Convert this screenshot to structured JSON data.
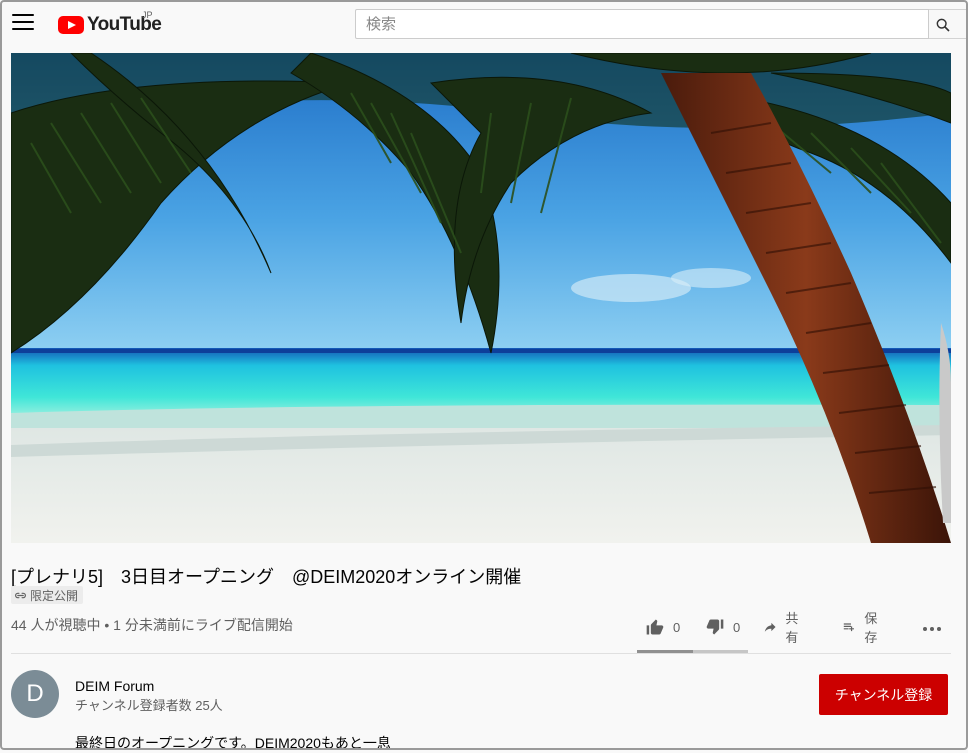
{
  "header": {
    "logo_text": "YouTube",
    "logo_region": "JP",
    "search_placeholder": "検索"
  },
  "video": {
    "title": "[プレナリ5]　3日目オープニング　@DEIM2020オンライン開催",
    "visibility_badge": "限定公開",
    "view_info": "44 人が視聴中 • 1 分未満前にライブ配信開始",
    "likes": "0",
    "dislikes": "0",
    "share_label": "共有",
    "save_label": "保存",
    "like_ratio": 0.5
  },
  "channel": {
    "avatar_letter": "D",
    "name": "DEIM Forum",
    "subscribers": "チャンネル登録者数 25人",
    "subscribe_label": "チャンネル登録"
  },
  "description": {
    "text": "最終日のオープニングです。DEIM2020もあと一息"
  },
  "icons": {
    "menu": "menu-icon",
    "search": "search-icon",
    "link": "link-icon",
    "like": "thumbs-up-icon",
    "dislike": "thumbs-down-icon",
    "share": "share-icon",
    "save": "playlist-add-icon",
    "more": "more-icon"
  },
  "colors": {
    "brand_red": "#ff0000",
    "subscribe_bg": "#cc0000",
    "avatar_bg": "#7b8c96"
  }
}
